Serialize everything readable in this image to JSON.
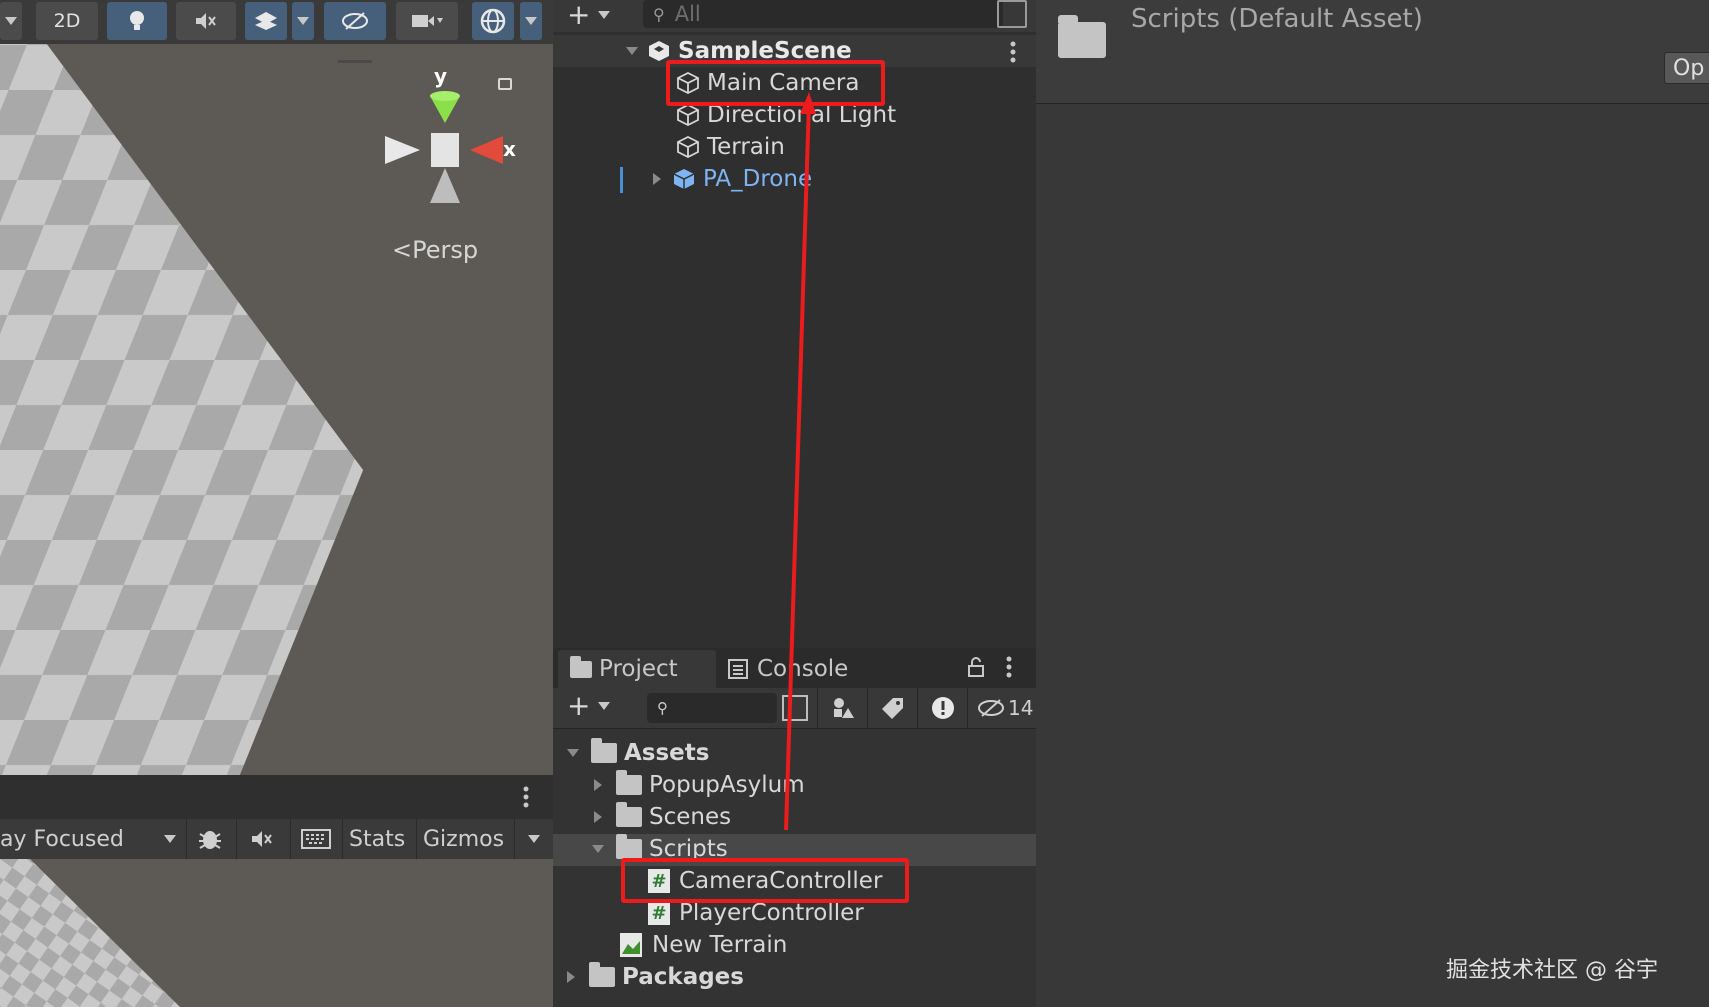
{
  "scene_toolbar": {
    "mode_2d_label": "2D",
    "icons": [
      "lightbulb-icon",
      "audio-mute-icon",
      "effects-icon",
      "visibility-icon",
      "camera-icon",
      "gizmo-orbit-icon"
    ]
  },
  "scene_view": {
    "gizmo_axis_y": "y",
    "gizmo_axis_x": "x",
    "projection_label": "Persp"
  },
  "game_toolbar": {
    "focus_label": "ay Focused",
    "stats_label": "Stats",
    "gizmos_label": "Gizmos"
  },
  "hierarchy": {
    "search_placeholder": "All",
    "scene_name": "SampleScene",
    "items": [
      {
        "label": "Main Camera"
      },
      {
        "label": "Directional Light"
      },
      {
        "label": "Terrain"
      },
      {
        "label": "PA_Drone"
      }
    ]
  },
  "project_panel": {
    "tabs": [
      {
        "label": "Project"
      },
      {
        "label": "Console"
      }
    ],
    "hidden_count": "14",
    "tree": [
      {
        "label": "Assets"
      },
      {
        "label": "PopupAsylum"
      },
      {
        "label": "Scenes"
      },
      {
        "label": "Scripts"
      },
      {
        "label": "CameraController"
      },
      {
        "label": "PlayerController"
      },
      {
        "label": "New Terrain"
      },
      {
        "label": "Packages"
      }
    ],
    "script_glyph": "#"
  },
  "inspector": {
    "title": "Scripts (Default Asset)",
    "open_button_label": "Op"
  },
  "watermark": "掘金技术社区 @ 谷宇",
  "colors": {
    "highlight_red": "#ec1c1c",
    "prefab_blue": "#7fb4f2",
    "active_blue": "#46607c",
    "gizmo_green": "#8be04a",
    "gizmo_red": "#e24a3c"
  }
}
